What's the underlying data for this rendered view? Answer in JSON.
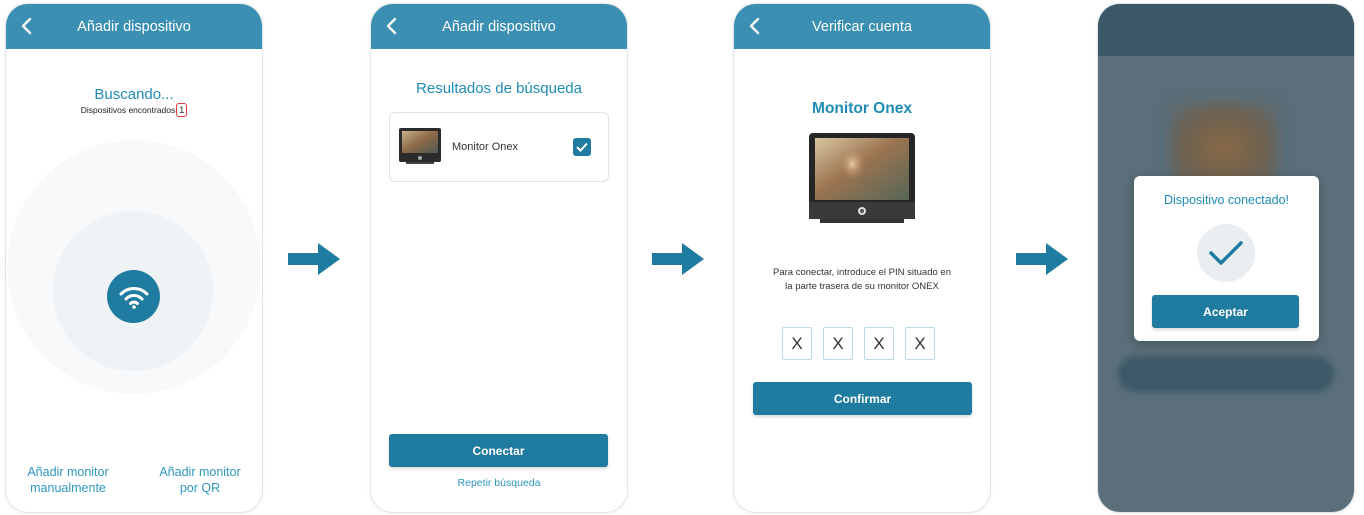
{
  "screen1": {
    "header_title": "Añadir dispositivo",
    "status_title": "Buscando...",
    "found_label": "Dispositivos encontrados",
    "found_count": "1",
    "manual_link_line1": "Añadir monitor",
    "manual_link_line2": "manualmente",
    "qr_link_line1": "Añadir monitor",
    "qr_link_line2": "por QR"
  },
  "screen2": {
    "header_title": "Añadir dispositivo",
    "results_title": "Resultados de búsqueda",
    "device_name": "Monitor Onex",
    "device_checked": true,
    "connect_label": "Conectar",
    "repeat_label": "Repetir búsqueda"
  },
  "screen3": {
    "header_title": "Verificar cuenta",
    "device_title": "Monitor Onex",
    "instruction_line1": "Para conectar, introduce el PIN situado en",
    "instruction_line2": "la parte trasera de su monitor ONEX",
    "pin_digits": [
      "X",
      "X",
      "X",
      "X"
    ],
    "confirm_label": "Confirmar"
  },
  "screen4": {
    "modal_title": "Dispositivo conectado!",
    "accept_label": "Aceptar"
  },
  "colors": {
    "header": "#3a8fb3",
    "accent": "#1e8cb5",
    "button": "#1f7ba0",
    "arrow": "#1f7ba0",
    "alert_red": "#e03a3a"
  },
  "icons": [
    "back-chevron-icon",
    "wifi-icon",
    "checkbox-checked-icon",
    "checkmark-icon",
    "flow-arrow-icon",
    "monitor-device-image"
  ]
}
